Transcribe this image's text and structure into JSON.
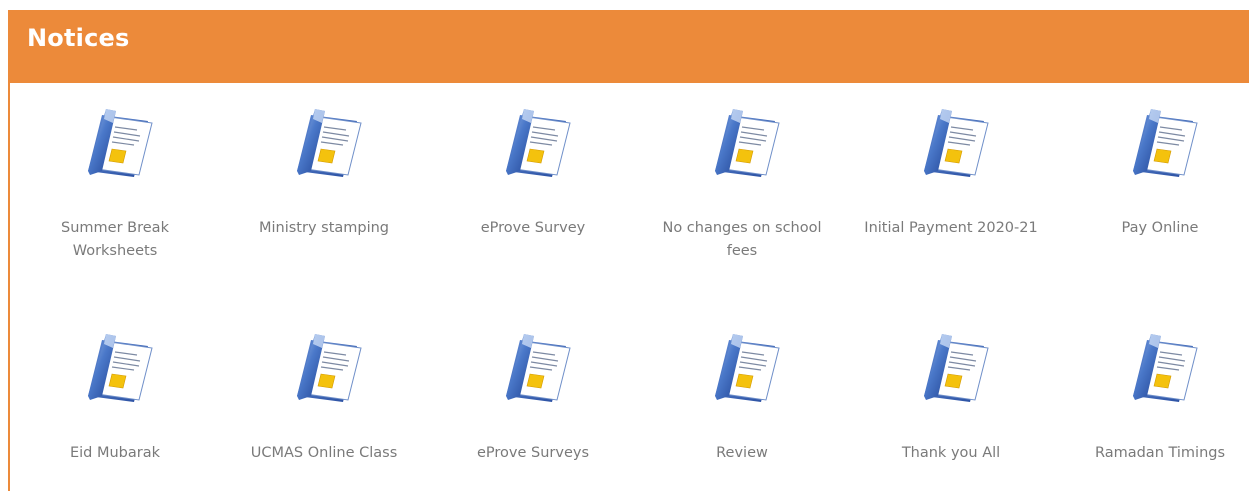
{
  "panel": {
    "title": "Notices",
    "accent_color": "#ec8a3a"
  },
  "notices": [
    {
      "label": "Summer Break Worksheets",
      "icon": "document-folder-icon"
    },
    {
      "label": "Ministry stamping",
      "icon": "document-folder-icon"
    },
    {
      "label": "eProve Survey",
      "icon": "document-folder-icon"
    },
    {
      "label": "No changes on school fees",
      "icon": "document-folder-icon"
    },
    {
      "label": "Initial Payment 2020-21",
      "icon": "document-folder-icon"
    },
    {
      "label": "Pay Online",
      "icon": "document-folder-icon"
    },
    {
      "label": "Eid Mubarak",
      "icon": "document-folder-icon"
    },
    {
      "label": "UCMAS Online Class",
      "icon": "document-folder-icon"
    },
    {
      "label": "eProve Surveys",
      "icon": "document-folder-icon"
    },
    {
      "label": "Review",
      "icon": "document-folder-icon"
    },
    {
      "label": "Thank you All",
      "icon": "document-folder-icon"
    },
    {
      "label": "Ramadan Timings",
      "icon": "document-folder-icon"
    }
  ]
}
